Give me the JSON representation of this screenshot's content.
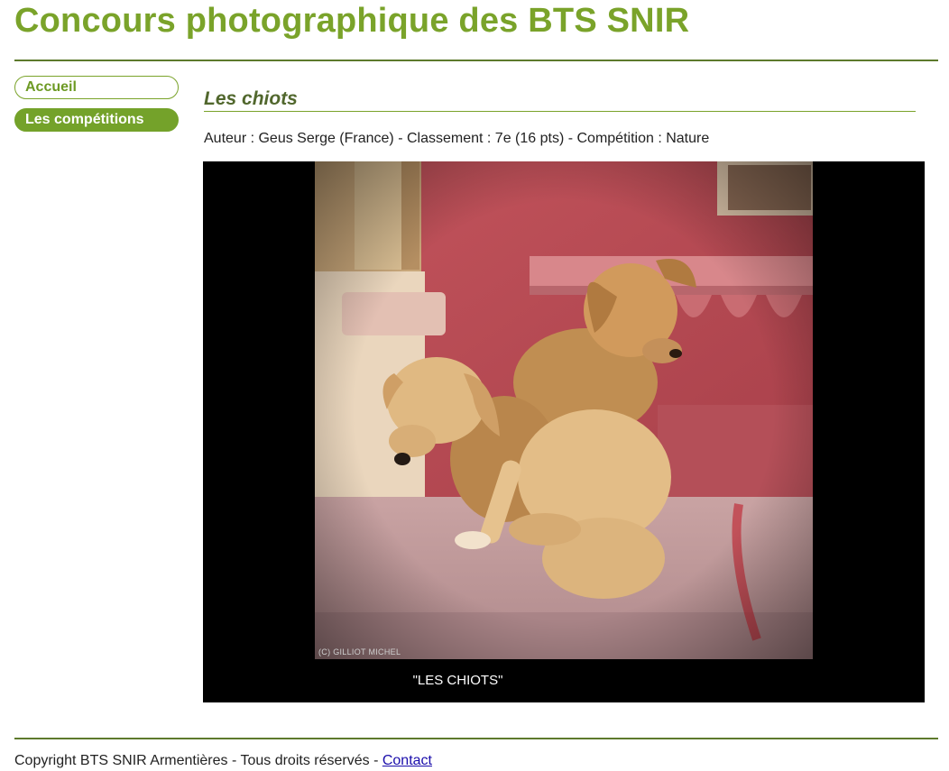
{
  "site": {
    "title": "Concours photographique des BTS SNIR"
  },
  "nav": {
    "items": [
      {
        "label": "Accueil",
        "active": false
      },
      {
        "label": "Les compétitions",
        "active": true
      }
    ]
  },
  "photo": {
    "title": "Les chiots",
    "meta": "Auteur : Geus Serge (France) - Classement : 7e (16 pts) - Compétition : Nature",
    "credit": "(C) GILLIOT MICHEL",
    "caption": "\"LES CHIOTS\""
  },
  "footer": {
    "text": "Copyright BTS SNIR Armentières - Tous droits réservés - ",
    "link_label": "Contact"
  }
}
